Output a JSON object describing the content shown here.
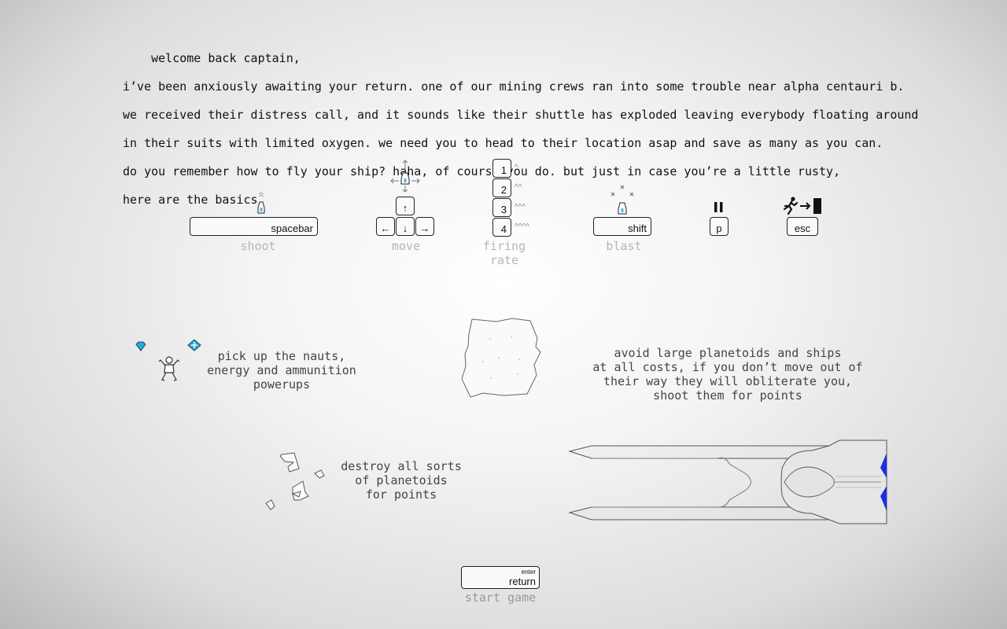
{
  "intro": {
    "lines": [
      "    welcome back captain,",
      "i’ve been anxiously awaiting your return. one of our mining crews ran into some trouble near alpha centauri b.",
      "we received their distress call, and it sounds like their shuttle has exploded leaving everybody floating around",
      "in their suits with limited oxygen. we need you to head to their location asap and save as many as you can.",
      "do you remember how to fly your ship? haha, of course you do. but just in case you’re a little rusty,",
      "here are the basics."
    ]
  },
  "controls": {
    "shoot": {
      "key": "spacebar",
      "label": "shoot"
    },
    "move": {
      "keys": [
        "↑",
        "←",
        "↓",
        "→"
      ],
      "label": "move"
    },
    "firing_rate": {
      "keys": [
        "1",
        "2",
        "3",
        "4"
      ],
      "carets": [
        "^",
        "^^",
        "^^^",
        "^^^^"
      ],
      "label_line1": "firing",
      "label_line2": "rate"
    },
    "blast": {
      "key": "shift",
      "label": "blast"
    },
    "pause": {
      "key": "p",
      "icon": "pause-icon"
    },
    "exit": {
      "key": "esc",
      "icon": "exit-door-icon"
    }
  },
  "tips": {
    "powerups": [
      "pick up the nauts,",
      "energy and ammunition",
      "powerups"
    ],
    "avoid": [
      "avoid large planetoids and ships",
      "at all costs, if you don’t move out of",
      "their way they will obliterate you,",
      "shoot them for points"
    ],
    "destroy": [
      "destroy all sorts",
      "of planetoids",
      "for points"
    ]
  },
  "start": {
    "key_small": "enter",
    "key_main": "return",
    "label": "start game"
  },
  "colors": {
    "accent_blue": "#1a2fe0",
    "powerup_blue": "#2aa8d8",
    "label_gray": "#b5b5b5"
  }
}
